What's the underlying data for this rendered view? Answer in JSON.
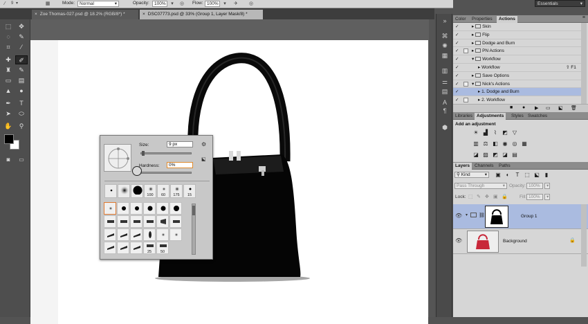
{
  "options_bar": {
    "brush_size": "9",
    "mode_label": "Mode:",
    "mode_value": "Normal",
    "opacity_label": "Opacity:",
    "opacity_value": "100%",
    "flow_label": "Flow:",
    "flow_value": "100%"
  },
  "workspace": "Essentials",
  "tabs": [
    {
      "title": "Zoe Thomas-027.psd @ 18.2% (RGB/8*) *",
      "active": false
    },
    {
      "title": "DSC07773.psd @ 33% (Group 1, Layer Mask/8) *",
      "active": true
    }
  ],
  "brush_panel": {
    "size_label": "Size:",
    "size_value": "9 px",
    "hardness_label": "Hardness:",
    "hardness_value": "0%",
    "top_presets": [
      "",
      "",
      "",
      "100",
      "60",
      "175",
      "15"
    ],
    "grid_labels": [
      "",
      "",
      "",
      "",
      "",
      "",
      "",
      "",
      "",
      "",
      "",
      "",
      "",
      "",
      "",
      "",
      "",
      "",
      "",
      "",
      "",
      "25",
      "50"
    ]
  },
  "panels_top": {
    "tabs": [
      "Color",
      "Properties",
      "Actions"
    ],
    "active_tab": "Actions",
    "actions": [
      {
        "label": "Skin",
        "indent": 1,
        "folder": true,
        "checked": true,
        "dialog": false,
        "selected": false
      },
      {
        "label": "Flip",
        "indent": 1,
        "folder": true,
        "checked": true,
        "dialog": false,
        "selected": false
      },
      {
        "label": "Dodge and Burn",
        "indent": 1,
        "folder": true,
        "checked": true,
        "dialog": false,
        "selected": false
      },
      {
        "label": "PN Actions",
        "indent": 1,
        "folder": true,
        "checked": true,
        "dialog": true,
        "selected": false
      },
      {
        "label": "Workflow",
        "indent": 1,
        "folder": true,
        "checked": true,
        "dialog": false,
        "selected": false,
        "open": true
      },
      {
        "label": "Workflow",
        "indent": 2,
        "folder": false,
        "checked": true,
        "dialog": false,
        "selected": false,
        "shortcut": "⇧ F1"
      },
      {
        "label": "Save Options",
        "indent": 1,
        "folder": true,
        "checked": true,
        "dialog": false,
        "selected": false
      },
      {
        "label": "Nick's Actions",
        "indent": 1,
        "folder": true,
        "checked": true,
        "dialog": true,
        "selected": false,
        "open": true
      },
      {
        "label": "1. Dodge and Burn",
        "indent": 2,
        "folder": false,
        "checked": true,
        "dialog": false,
        "selected": true
      },
      {
        "label": "2. Workflow",
        "indent": 2,
        "folder": false,
        "checked": true,
        "dialog": true,
        "selected": false
      }
    ]
  },
  "panels_mid": {
    "tabs": [
      "Libraries",
      "Adjustments",
      "Styles",
      "Swatches"
    ],
    "active_tab": "Adjustments",
    "heading": "Add an adjustment"
  },
  "layers_panel": {
    "tabs": [
      "Layers",
      "Channels",
      "Paths"
    ],
    "active_tab": "Layers",
    "filter": "Kind",
    "blend_mode": "Pass Through",
    "opacity_label": "Opacity:",
    "opacity_value": "100%",
    "lock_label": "Lock:",
    "fill_label": "Fill:",
    "fill_value": "100%",
    "layers": [
      {
        "name": "Group 1",
        "selected": true
      },
      {
        "name": "Background",
        "selected": false
      }
    ]
  },
  "colors": {
    "selection": "#aabbe0",
    "bag_red": "#c8283a",
    "hardness_border": "#e08a2c"
  }
}
